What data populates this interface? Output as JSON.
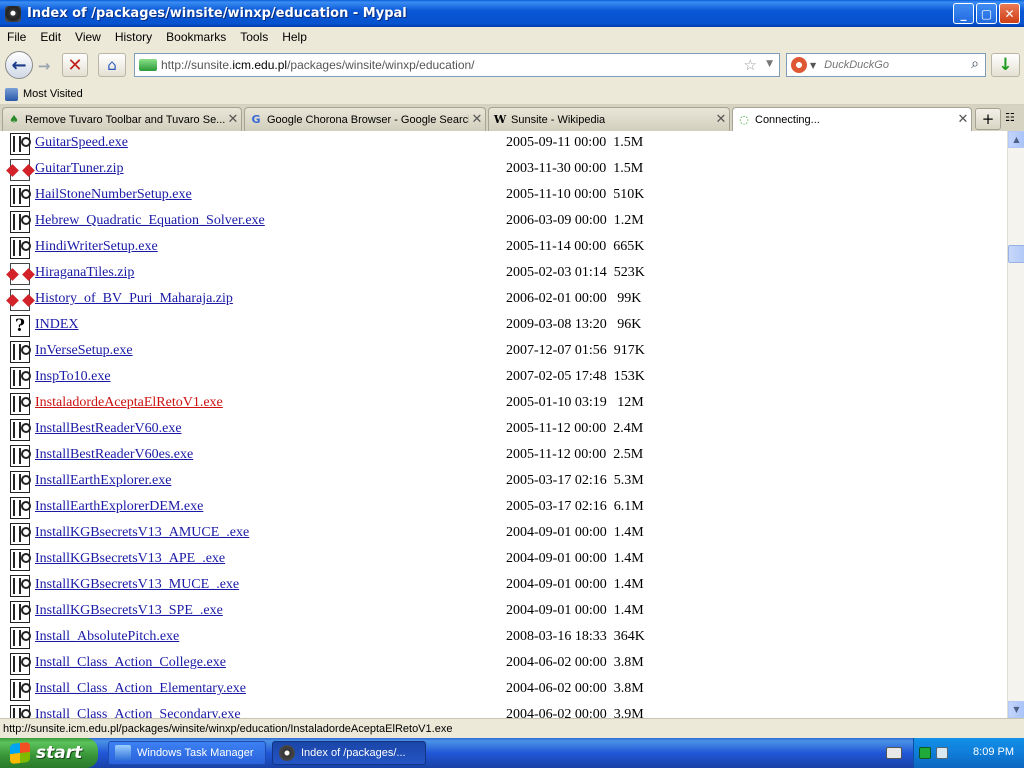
{
  "window": {
    "title": "Index of /packages/winsite/winxp/education - Mypal",
    "buttons": {
      "minimize": "_",
      "maximize": "▢",
      "close": "✕"
    }
  },
  "menu": [
    "File",
    "Edit",
    "View",
    "History",
    "Bookmarks",
    "Tools",
    "Help"
  ],
  "nav": {
    "url_prefix": "http://sunsite.",
    "url_domain": "icm.edu.pl",
    "url_path": "/packages/winsite/winxp/education/",
    "search_placeholder": "DuckDuckGo"
  },
  "bookmarks": {
    "most_visited": "Most Visited"
  },
  "tabs": [
    {
      "label": "Remove Tuvaro Toolbar and Tuvaro Se...",
      "icon": "tuvaro-icon",
      "active": false
    },
    {
      "label": "Google Chorona Browser - Google Search",
      "icon": "google-icon",
      "active": false
    },
    {
      "label": "Sunsite - Wikipedia",
      "icon": "wikipedia-icon",
      "active": false
    },
    {
      "label": "Connecting...",
      "icon": "loading-icon",
      "active": true
    }
  ],
  "files": [
    {
      "name": "GuitarSpeed.exe",
      "date": "2005-09-11 00:00",
      "size": "1.5M",
      "type": "exe"
    },
    {
      "name": "GuitarTuner.zip",
      "date": "2003-11-30 00:00",
      "size": "1.5M",
      "type": "zip"
    },
    {
      "name": "HailStoneNumberSetup.exe",
      "date": "2005-11-10 00:00",
      "size": "510K",
      "type": "exe"
    },
    {
      "name": "Hebrew_Quadratic_Equation_Solver.exe",
      "date": "2006-03-09 00:00",
      "size": "1.2M",
      "type": "exe"
    },
    {
      "name": "HindiWriterSetup.exe",
      "date": "2005-11-14 00:00",
      "size": "665K",
      "type": "exe"
    },
    {
      "name": "HiraganaTiles.zip",
      "date": "2005-02-03 01:14",
      "size": "523K",
      "type": "zip"
    },
    {
      "name": "History_of_BV_Puri_Maharaja.zip",
      "date": "2006-02-01 00:00",
      "size": " 99K",
      "type": "zip"
    },
    {
      "name": "INDEX",
      "date": "2009-03-08 13:20",
      "size": " 96K",
      "type": "unknown"
    },
    {
      "name": "InVerseSetup.exe",
      "date": "2007-12-07 01:56",
      "size": "917K",
      "type": "exe"
    },
    {
      "name": "InspTo10.exe",
      "date": "2007-02-05 17:48",
      "size": "153K",
      "type": "exe"
    },
    {
      "name": "InstaladordeAceptaElRetoV1.exe",
      "date": "2005-01-10 03:19",
      "size": " 12M",
      "type": "exe",
      "hover": true
    },
    {
      "name": "InstallBestReaderV60.exe",
      "date": "2005-11-12 00:00",
      "size": "2.4M",
      "type": "exe"
    },
    {
      "name": "InstallBestReaderV60es.exe",
      "date": "2005-11-12 00:00",
      "size": "2.5M",
      "type": "exe"
    },
    {
      "name": "InstallEarthExplorer.exe",
      "date": "2005-03-17 02:16",
      "size": "5.3M",
      "type": "exe"
    },
    {
      "name": "InstallEarthExplorerDEM.exe",
      "date": "2005-03-17 02:16",
      "size": "6.1M",
      "type": "exe"
    },
    {
      "name": "InstallKGBsecretsV13_AMUCE_.exe",
      "date": "2004-09-01 00:00",
      "size": "1.4M",
      "type": "exe"
    },
    {
      "name": "InstallKGBsecretsV13_APE_.exe",
      "date": "2004-09-01 00:00",
      "size": "1.4M",
      "type": "exe"
    },
    {
      "name": "InstallKGBsecretsV13_MUCE_.exe",
      "date": "2004-09-01 00:00",
      "size": "1.4M",
      "type": "exe"
    },
    {
      "name": "InstallKGBsecretsV13_SPE_.exe",
      "date": "2004-09-01 00:00",
      "size": "1.4M",
      "type": "exe"
    },
    {
      "name": "Install_AbsolutePitch.exe",
      "date": "2008-03-16 18:33",
      "size": "364K",
      "type": "exe"
    },
    {
      "name": "Install_Class_Action_College.exe",
      "date": "2004-06-02 00:00",
      "size": "3.8M",
      "type": "exe"
    },
    {
      "name": "Install_Class_Action_Elementary.exe",
      "date": "2004-06-02 00:00",
      "size": "3.8M",
      "type": "exe"
    },
    {
      "name": "Install_Class_Action_Secondary.exe",
      "date": "2004-06-02 00:00",
      "size": "3.9M",
      "type": "exe"
    }
  ],
  "status": {
    "text": "http://sunsite.icm.edu.pl/packages/winsite/winxp/education/InstaladordeAceptaElRetoV1.exe"
  },
  "taskbar": {
    "start_label": "start",
    "tasks": [
      {
        "label": "Windows Task Manager",
        "active": false
      },
      {
        "label": "Index of /packages/...",
        "active": true
      }
    ],
    "clock": "8:09 PM"
  },
  "colors": {
    "link": "#1a1aa6",
    "link_hover": "#cc1111",
    "titlebar": "#0a58d6",
    "taskbar": "#2157d7"
  }
}
